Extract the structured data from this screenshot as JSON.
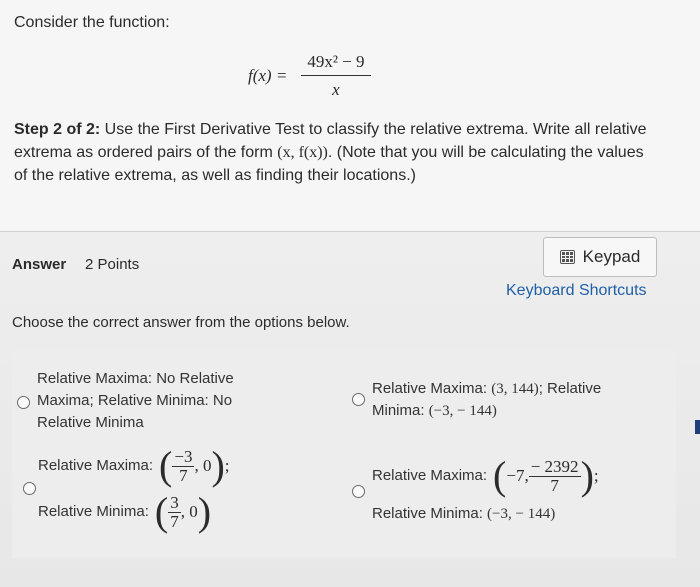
{
  "question": {
    "intro": "Consider the function:",
    "formula": {
      "lhs": "f(x) =",
      "numerator": "49x² − 9",
      "denominator": "x"
    },
    "step_label": "Step 2 of 2:",
    "step_text_1": " Use the First Derivative Test to classify the relative extrema. Write all relative extrema as ordered pairs of the form ",
    "step_math": "(x, f(x))",
    "step_text_2": ". (Note that you will be calculating the values of the relative extrema, as well as finding their locations.)"
  },
  "answer": {
    "label": "Answer",
    "points": "2 Points",
    "keypad_label": "Keypad",
    "keyboard_shortcuts": "Keyboard Shortcuts",
    "instruction": "Choose the correct answer from the options below."
  },
  "options": {
    "a": {
      "line1": "Relative Maxima: No Relative",
      "line2": "Maxima; Relative Minima: No",
      "line3": "Relative Minima"
    },
    "b": {
      "line1_pre": "Relative Maxima: ",
      "line1_math": "(3, 144)",
      "line1_post": "; Relative",
      "line2_pre": "Minima: ",
      "line2_math": "(−3, − 144)"
    },
    "c": {
      "max_label": "Relative Maxima:",
      "max_num": "−3",
      "max_den": "7",
      "max_y": ", 0",
      "max_end": ";",
      "min_label": "Relative Minima:",
      "min_num": "3",
      "min_den": "7",
      "min_y": ", 0"
    },
    "d": {
      "max_label": "Relative Maxima:",
      "max_x": "−7, ",
      "max_num": "− 2392",
      "max_den": "7",
      "max_end": ";",
      "min_label": "Relative Minima: ",
      "min_math": "(−3, − 144)"
    }
  },
  "colors": {
    "link": "#1f5fa8",
    "text": "#2b2b2b"
  }
}
